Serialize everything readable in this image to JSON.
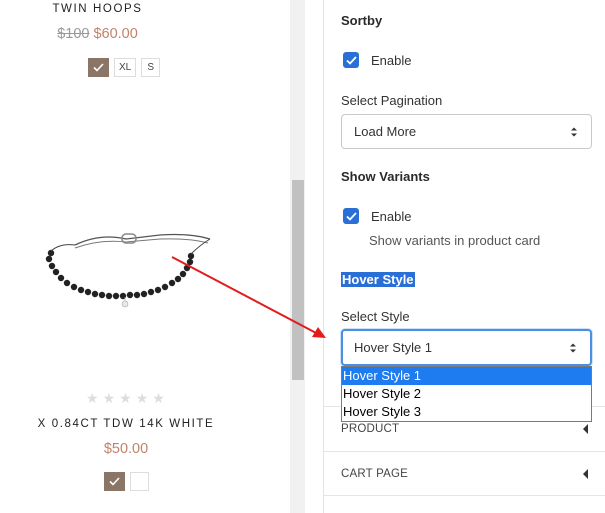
{
  "preview": {
    "product1": {
      "title": "TWIN HOOPS",
      "price_old": "$100",
      "price_new": "$60.00",
      "swatches": [
        "XL",
        "S"
      ]
    },
    "product2": {
      "title": "X 0.84CT TDW 14K WHITE",
      "price": "$50.00",
      "rating": 0,
      "max_rating": 5
    }
  },
  "settings": {
    "sortby": {
      "title": "Sortby",
      "enable_label": "Enable",
      "checked": true
    },
    "pagination": {
      "label": "Select Pagination",
      "selected": "Load More"
    },
    "show_variants": {
      "title": "Show Variants",
      "enable_label": "Enable",
      "checked": true,
      "help": "Show variants in product card"
    },
    "hover_style": {
      "title": "Hover Style",
      "label": "Select Style",
      "selected": "Hover Style 1",
      "options": [
        "Hover Style 1",
        "Hover Style 2",
        "Hover Style 3"
      ]
    },
    "sections": {
      "product": "PRODUCT",
      "cart_page": "CART PAGE"
    }
  },
  "colors": {
    "accent": "#2a6fd6",
    "price": "#c0836a",
    "annotation_arrow": "#e21b1b"
  }
}
